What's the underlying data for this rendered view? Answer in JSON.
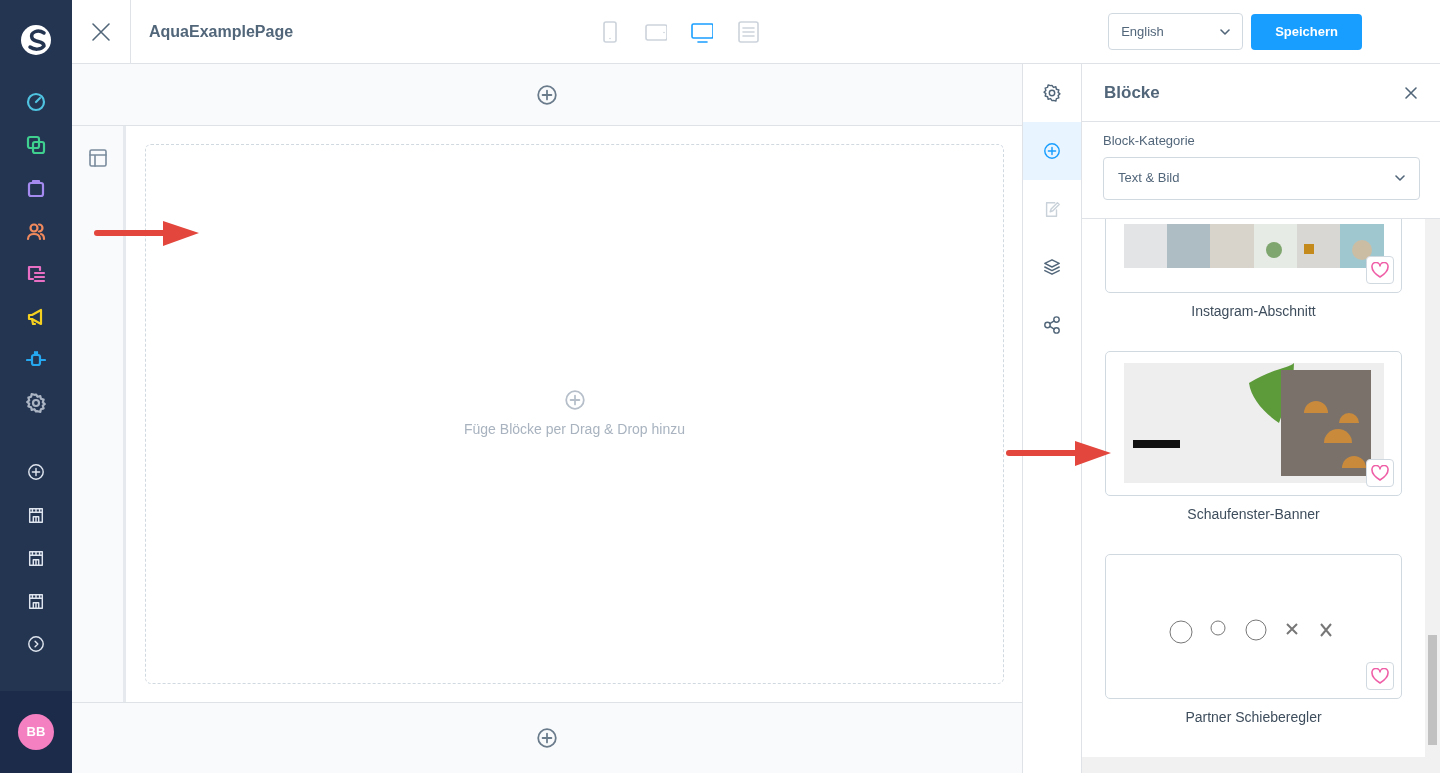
{
  "sidebar": {
    "items": [
      {
        "kind": "dashboard",
        "color": "#4fc3e0"
      },
      {
        "kind": "catalog",
        "color": "#3fcf8e"
      },
      {
        "kind": "orders",
        "color": "#a58bf0"
      },
      {
        "kind": "customers",
        "color": "#f08a5d"
      },
      {
        "kind": "content",
        "color": "#e86fc4"
      },
      {
        "kind": "marketing",
        "color": "#f5d020"
      },
      {
        "kind": "extensions",
        "color": "#26a8f0"
      },
      {
        "kind": "settings",
        "color": "#aab4c3"
      }
    ],
    "bottom_items": [
      {
        "kind": "add"
      },
      {
        "kind": "store"
      },
      {
        "kind": "store"
      },
      {
        "kind": "store"
      },
      {
        "kind": "expand"
      }
    ],
    "avatar": "BB"
  },
  "topbar": {
    "title": "AquaExamplePage",
    "devices": [
      {
        "kind": "mobile",
        "selected": false
      },
      {
        "kind": "tablet",
        "selected": false
      },
      {
        "kind": "desktop",
        "selected": true
      },
      {
        "kind": "list",
        "selected": false
      }
    ],
    "language": "English",
    "save_button": "Speichern"
  },
  "canvas": {
    "empty_text": "Füge Blöcke per Drag & Drop hinzu"
  },
  "rail": [
    {
      "kind": "settings",
      "selected": false,
      "disabled": false
    },
    {
      "kind": "add",
      "selected": true,
      "disabled": false
    },
    {
      "kind": "edit",
      "selected": false,
      "disabled": true
    },
    {
      "kind": "layers",
      "selected": false,
      "disabled": false
    },
    {
      "kind": "share",
      "selected": false,
      "disabled": false
    }
  ],
  "panel": {
    "title": "Blöcke",
    "category_label": "Block-Kategorie",
    "category": "Text & Bild",
    "blocks": [
      {
        "kind": "instagram",
        "name": "Instagram-Abschnitt"
      },
      {
        "kind": "banner",
        "name": "Schaufenster-Banner"
      },
      {
        "kind": "partners",
        "name": "Partner Schieberegler"
      }
    ]
  }
}
